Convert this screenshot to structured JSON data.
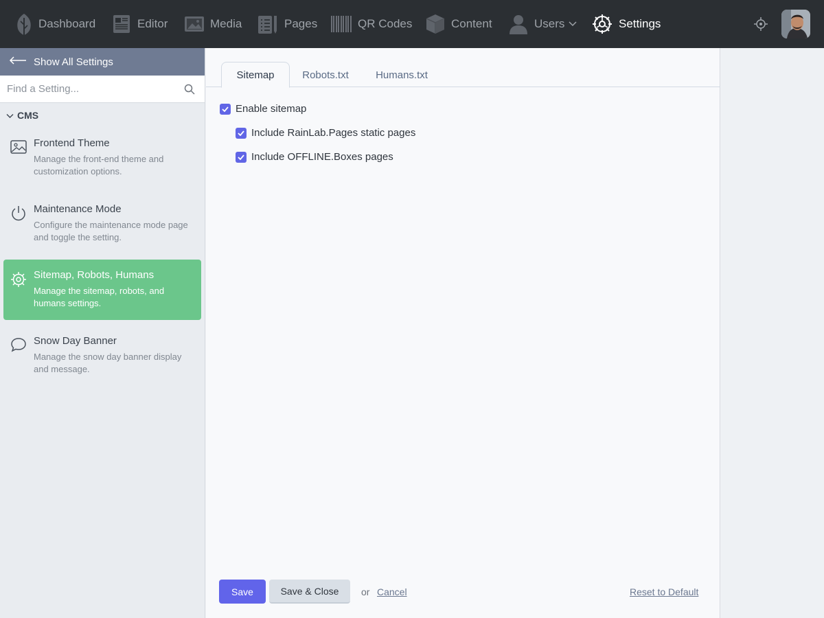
{
  "nav": {
    "items": [
      {
        "label": "Dashboard",
        "icon": "leaf-icon"
      },
      {
        "label": "Editor",
        "icon": "newspaper-icon"
      },
      {
        "label": "Media",
        "icon": "image-icon"
      },
      {
        "label": "Pages",
        "icon": "pages-icon"
      },
      {
        "label": "QR Codes",
        "icon": "barcode-icon"
      },
      {
        "label": "Content",
        "icon": "cube-icon"
      },
      {
        "label": "Users",
        "icon": "user-icon"
      },
      {
        "label": "Settings",
        "icon": "gear-icon"
      }
    ],
    "active": "Settings"
  },
  "sidebar": {
    "show_all_label": "Show All Settings",
    "search_placeholder": "Find a Setting...",
    "group_label": "CMS",
    "items": [
      {
        "title": "Frontend Theme",
        "desc": "Manage the front-end theme and customization options.",
        "icon": "image-icon"
      },
      {
        "title": "Maintenance Mode",
        "desc": "Configure the maintenance mode page and toggle the setting.",
        "icon": "power-icon"
      },
      {
        "title": "Sitemap, Robots, Humans",
        "desc": "Manage the sitemap, robots, and humans settings.",
        "icon": "gear-icon",
        "active": true
      },
      {
        "title": "Snow Day Banner",
        "desc": "Manage the snow day banner display and message.",
        "icon": "speech-bubble-icon"
      }
    ]
  },
  "tabs": [
    {
      "label": "Sitemap",
      "active": true
    },
    {
      "label": "Robots.txt"
    },
    {
      "label": "Humans.txt"
    }
  ],
  "form": {
    "enable_sitemap": {
      "label": "Enable sitemap",
      "checked": true
    },
    "include_static": {
      "label": "Include RainLab.Pages static pages",
      "checked": true
    },
    "include_boxes": {
      "label": "Include OFFLINE.Boxes pages",
      "checked": true
    }
  },
  "actions": {
    "save": "Save",
    "save_close": "Save & Close",
    "or": "or",
    "cancel": "Cancel",
    "reset": "Reset to Default"
  },
  "colors": {
    "topbar": "#2b2f33",
    "accent": "#6164ea",
    "active_item": "#6bc68b",
    "show_all_bar": "#6f7b93"
  }
}
